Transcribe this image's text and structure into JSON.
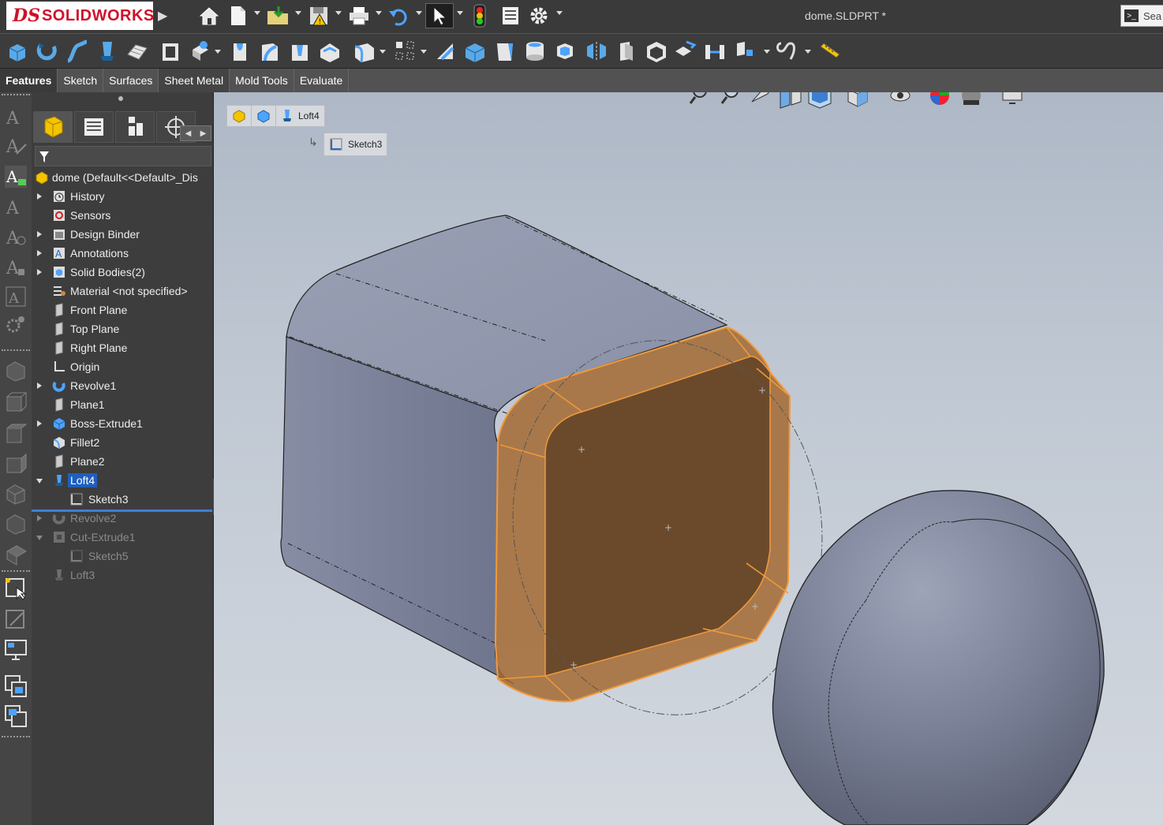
{
  "app": {
    "brand_ds": "DS",
    "brand_name": "SOLIDWORKS",
    "doc_title": "dome.SLDPRT *",
    "search_placeholder": "Sea"
  },
  "toolbar_icons": [
    "home-icon",
    "new-document-icon",
    "open-icon",
    "save-icon",
    "print-icon",
    "undo-icon",
    "select-icon",
    "rebuild-icon",
    "file-properties-icon",
    "options-icon"
  ],
  "command_icons": [
    "extruded-boss-icon",
    "revolved-boss-icon",
    "swept-boss-icon",
    "lofted-boss-icon",
    "boundary-boss-icon",
    "extruded-cut-icon",
    "hole-wizard-icon",
    "revolved-cut-icon",
    "swept-cut-icon",
    "lofted-cut-icon",
    "boundary-cut-icon",
    "fillet-icon",
    "linear-pattern-icon",
    "rib-icon",
    "wrap-icon",
    "draft-icon",
    "intersect-icon",
    "shell-icon",
    "mirror-icon",
    "reference-geometry-icon",
    "curves-icon",
    "instant3d-icon"
  ],
  "tabs": [
    "Features",
    "Sketch",
    "Surfaces",
    "Sheet Metal",
    "Mold Tools",
    "Evaluate"
  ],
  "tree": {
    "root": "dome  (Default<<Default>_Dis",
    "items": [
      {
        "label": "History"
      },
      {
        "label": "Sensors"
      },
      {
        "label": "Design Binder"
      },
      {
        "label": "Annotations"
      },
      {
        "label": "Solid Bodies(2)"
      },
      {
        "label": "Material <not specified>"
      },
      {
        "label": "Front Plane"
      },
      {
        "label": "Top Plane"
      },
      {
        "label": "Right Plane"
      },
      {
        "label": "Origin"
      },
      {
        "label": "Revolve1"
      },
      {
        "label": "Plane1"
      },
      {
        "label": "Boss-Extrude1"
      },
      {
        "label": "Fillet2"
      },
      {
        "label": "Plane2"
      },
      {
        "label": "Loft4"
      },
      {
        "label": "Sketch3"
      },
      {
        "label": "Revolve2"
      },
      {
        "label": "Cut-Extrude1"
      },
      {
        "label": "Sketch5"
      },
      {
        "label": "Loft3"
      }
    ]
  },
  "breadcrumb": {
    "feature": "Loft4",
    "child": "Sketch3"
  },
  "colors": {
    "selection": "#f29a3a",
    "accent_blue": "#1f5fbf"
  }
}
